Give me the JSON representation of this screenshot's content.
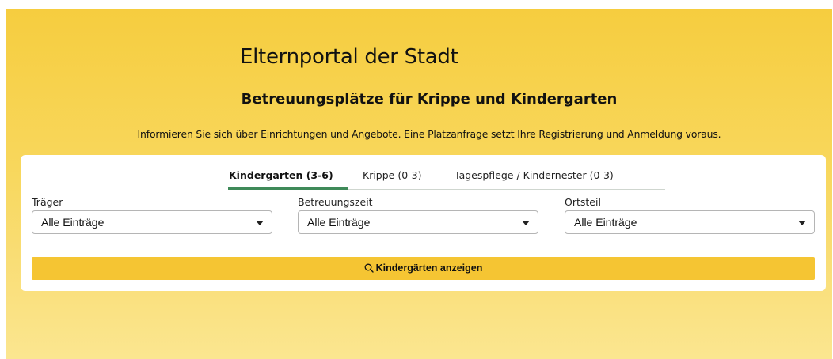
{
  "header": {
    "title": "Elternportal der Stadt",
    "subtitle": "Betreuungsplätze für Krippe und Kindergarten",
    "intro": "Informieren Sie sich über Einrichtungen und Angebote. Eine Platzanfrage setzt Ihre Registrierung und Anmeldung voraus."
  },
  "tabs": [
    {
      "label": "Kindergarten (3-6)",
      "active": true
    },
    {
      "label": "Krippe (0-3)",
      "active": false
    },
    {
      "label": "Tagespflege / Kindernester (0-3)",
      "active": false
    }
  ],
  "filters": [
    {
      "label": "Träger",
      "value": "Alle Einträge"
    },
    {
      "label": "Betreuungszeit",
      "value": "Alle Einträge"
    },
    {
      "label": "Ortsteil",
      "value": "Alle Einträge"
    }
  ],
  "search_button": {
    "label": "Kindergärten anzeigen",
    "icon": "search-icon"
  },
  "colors": {
    "hero_background": "#f7d04a",
    "button": "#f5c533",
    "active_tab_underline": "#3f8a59"
  }
}
